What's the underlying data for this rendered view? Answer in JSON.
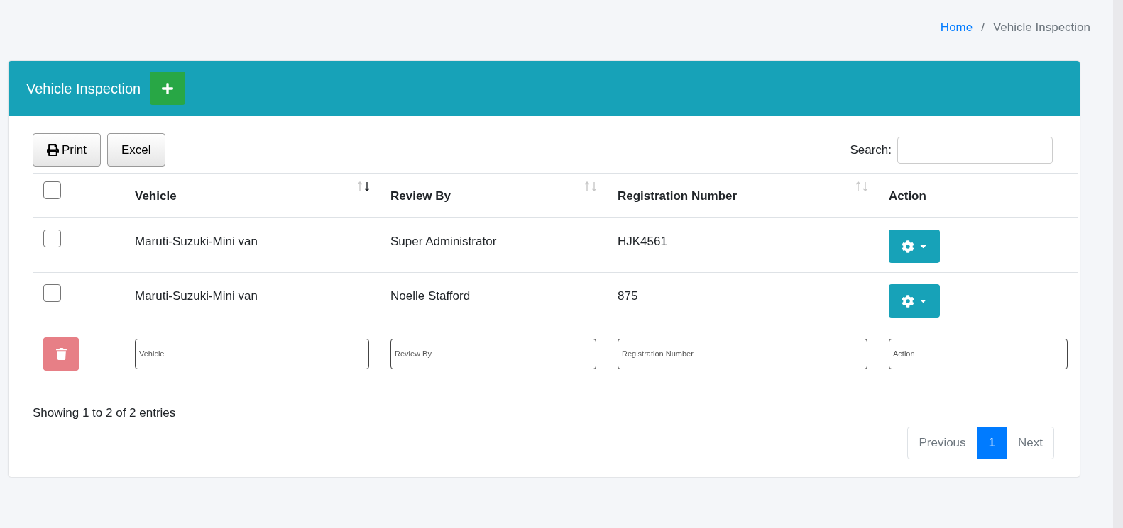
{
  "breadcrumb": [
    {
      "label": "Home",
      "link": true
    },
    {
      "label": "Vehicle Inspection",
      "link": false
    }
  ],
  "breadcrumb_separator": "/",
  "card": {
    "title": "Vehicle Inspection"
  },
  "toolbar": {
    "buttons": [
      {
        "label": "Print",
        "kind": "print"
      },
      {
        "label": "Excel",
        "kind": "plain"
      }
    ],
    "search_label": "Search:"
  },
  "table": {
    "select_all_checked": false,
    "columns": [
      {
        "label": "Vehicle",
        "sortable": true,
        "sorted_desc": true
      },
      {
        "label": "Review By",
        "sortable": true,
        "sorted_desc": false
      },
      {
        "label": "Registration Number",
        "sortable": true,
        "sorted_desc": false
      },
      {
        "label": "Action",
        "sortable": false
      }
    ],
    "rows": [
      {
        "checked": false,
        "cells": [
          "Maruti-Suzuki-Mini van",
          "Super Administrator",
          "HJK4561"
        ]
      },
      {
        "checked": false,
        "cells": [
          "Maruti-Suzuki-Mini van",
          "Noelle Stafford",
          "875"
        ]
      }
    ],
    "filters": [
      {
        "placeholder": "Vehicle"
      },
      {
        "placeholder": "Review By"
      },
      {
        "placeholder": "Registration Number"
      },
      {
        "placeholder": "Action"
      }
    ]
  },
  "info": "Showing 1 to 2 of 2 entries",
  "pagination": [
    {
      "label": "Previous",
      "selected": false
    },
    {
      "label": "1",
      "selected": true
    },
    {
      "label": "Next",
      "selected": false
    }
  ]
}
